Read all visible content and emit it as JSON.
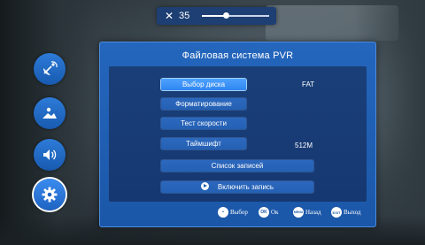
{
  "volume": {
    "icon": "speaker-icon",
    "value": "35",
    "level": 0.35
  },
  "side_menu": {
    "items": [
      {
        "name": "channel",
        "icon": "satellite-dish-icon",
        "active": false
      },
      {
        "name": "picture",
        "icon": "landscape-picture-icon",
        "active": false
      },
      {
        "name": "sound",
        "icon": "speaker-sound-icon",
        "active": false
      },
      {
        "name": "settings",
        "icon": "gear-icon",
        "active": true
      }
    ]
  },
  "dialog": {
    "title": "Файловая система PVR",
    "rows": {
      "select_disk": {
        "label": "Выбор диска",
        "value": "FAT",
        "selected": true
      },
      "format": {
        "label": "Форматирование"
      },
      "speed_test": {
        "label": "Тест скорости"
      },
      "timeshift": {
        "label": "Таймшифт",
        "value": "512M"
      },
      "record_list": {
        "label": "Список записей"
      },
      "start_record": {
        "label": "Включить запись"
      }
    }
  },
  "hints": {
    "select": {
      "icon": "dpad-icon",
      "label": "Выбор"
    },
    "ok": {
      "key": "OK",
      "label": "Ок"
    },
    "back": {
      "key": "MENU",
      "label": "Назад"
    },
    "exit": {
      "key": "EXIT",
      "label": "Выход"
    }
  },
  "colors": {
    "accent": "#2f86f0",
    "dialog_bg": "#1b57a8",
    "panel_bg": "#163872",
    "side_button": "#1f63c2"
  }
}
